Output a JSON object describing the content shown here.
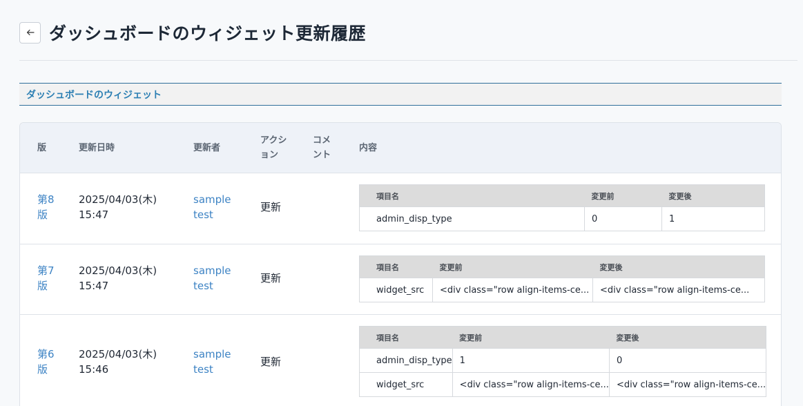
{
  "header": {
    "title": "ダッシュボードのウィジェット更新履歴",
    "back_icon": "arrow-left-icon"
  },
  "section": {
    "title": "ダッシュボードのウィジェット"
  },
  "table": {
    "columns": {
      "version": "版",
      "updated_at": "更新日時",
      "updated_by": "更新者",
      "action": "アクション",
      "comment": "コメント",
      "content": "内容"
    },
    "diff_headers": {
      "item": "項目名",
      "before": "変更前",
      "after": "変更後"
    },
    "rows": [
      {
        "version": "第8版",
        "date": "2025/04/03(木)",
        "time": "15:47",
        "user": "sample test",
        "action": "更新",
        "comment": "",
        "changes": [
          {
            "item": "admin_disp_type",
            "before": "0",
            "after": "1"
          }
        ]
      },
      {
        "version": "第7版",
        "date": "2025/04/03(木)",
        "time": "15:47",
        "user": "sample test",
        "action": "更新",
        "comment": "",
        "changes": [
          {
            "item": "widget_src",
            "before": "<div class=\"row align-items-ce...",
            "after": "<div class=\"row align-items-ce..."
          }
        ]
      },
      {
        "version": "第6版",
        "date": "2025/04/03(木)",
        "time": "15:46",
        "user": "sample test",
        "action": "更新",
        "comment": "",
        "changes": [
          {
            "item": "admin_disp_type",
            "before": "1",
            "after": "0"
          },
          {
            "item": "widget_src",
            "before": "<div class=\"row align-items-ce...",
            "after": "<div class=\"row align-items-ce..."
          }
        ]
      }
    ]
  }
}
